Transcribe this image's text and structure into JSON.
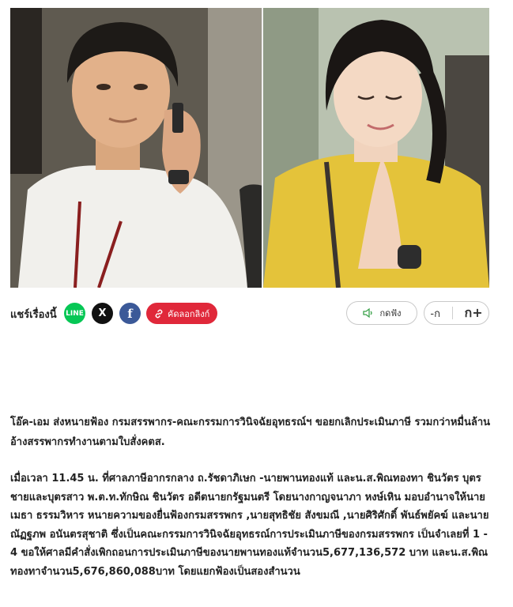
{
  "share": {
    "label": "แชร์เรื่องนี้",
    "line_label": "LINE",
    "x_label": "X",
    "facebook_label": "f",
    "copy_label": "คัดลอกลิงก์",
    "line_color": "#06c755",
    "copy_color": "#e0283a"
  },
  "audio": {
    "listen_label": "กดฟัง"
  },
  "font_size": {
    "decrease_label": "-ก",
    "increase_label": "ก+"
  },
  "article": {
    "lead": "โอ๊ค-เอม ส่งหนายฟ้อง กรมสรรพากร-คณะกรรมการวินิจฉัยอุทธรณ์ฯ ขอยกเลิกประเมินภาษี รวมกว่าหมื่นล้าน อ้างสรรพากรทำงานตามใบสั่งคตส.",
    "body": "เมื่อเวลา 11.45 น. ที่ศาลภาษีอากรกลาง ถ.รัชดาภิเษก -นายพานทองแท้ และน.ส.พิณทองทา ชินวัตร บุตรชายและบุตรสาว พ.ต.ท.ทักษิณ ชินวัตร อดีตนายกรัฐมนตรี โดยนางกาญจนาภา หงษ์เหิน มอบอำนาจให้นายเมธา ธรรมวิหาร หนายความของยื่นฟ้องกรมสรรพกร ,นายสุทธิชัย สังขมณี ,นายศิริศักดิ์ พันธ์พยัคฆ์ และนายณัฏฐภพ อนันตรสุชาติ ซึ่งเป็นคณะกรรมการวินิจฉัยอุทธรณ์การประเมินภาษีของกรมสรรพกร เป็นจำเลยที่ 1 - 4 ขอให้ศาลมีคำสั่งเพิกถอนการประเมินภาษีของนายพานทองแท้จำนวน5,677,136,572 บาท และน.ส.พิณทองทาจำนวน5,676,860,088บาท โดยแยกฟ้องเป็นสองสำนวน"
  }
}
